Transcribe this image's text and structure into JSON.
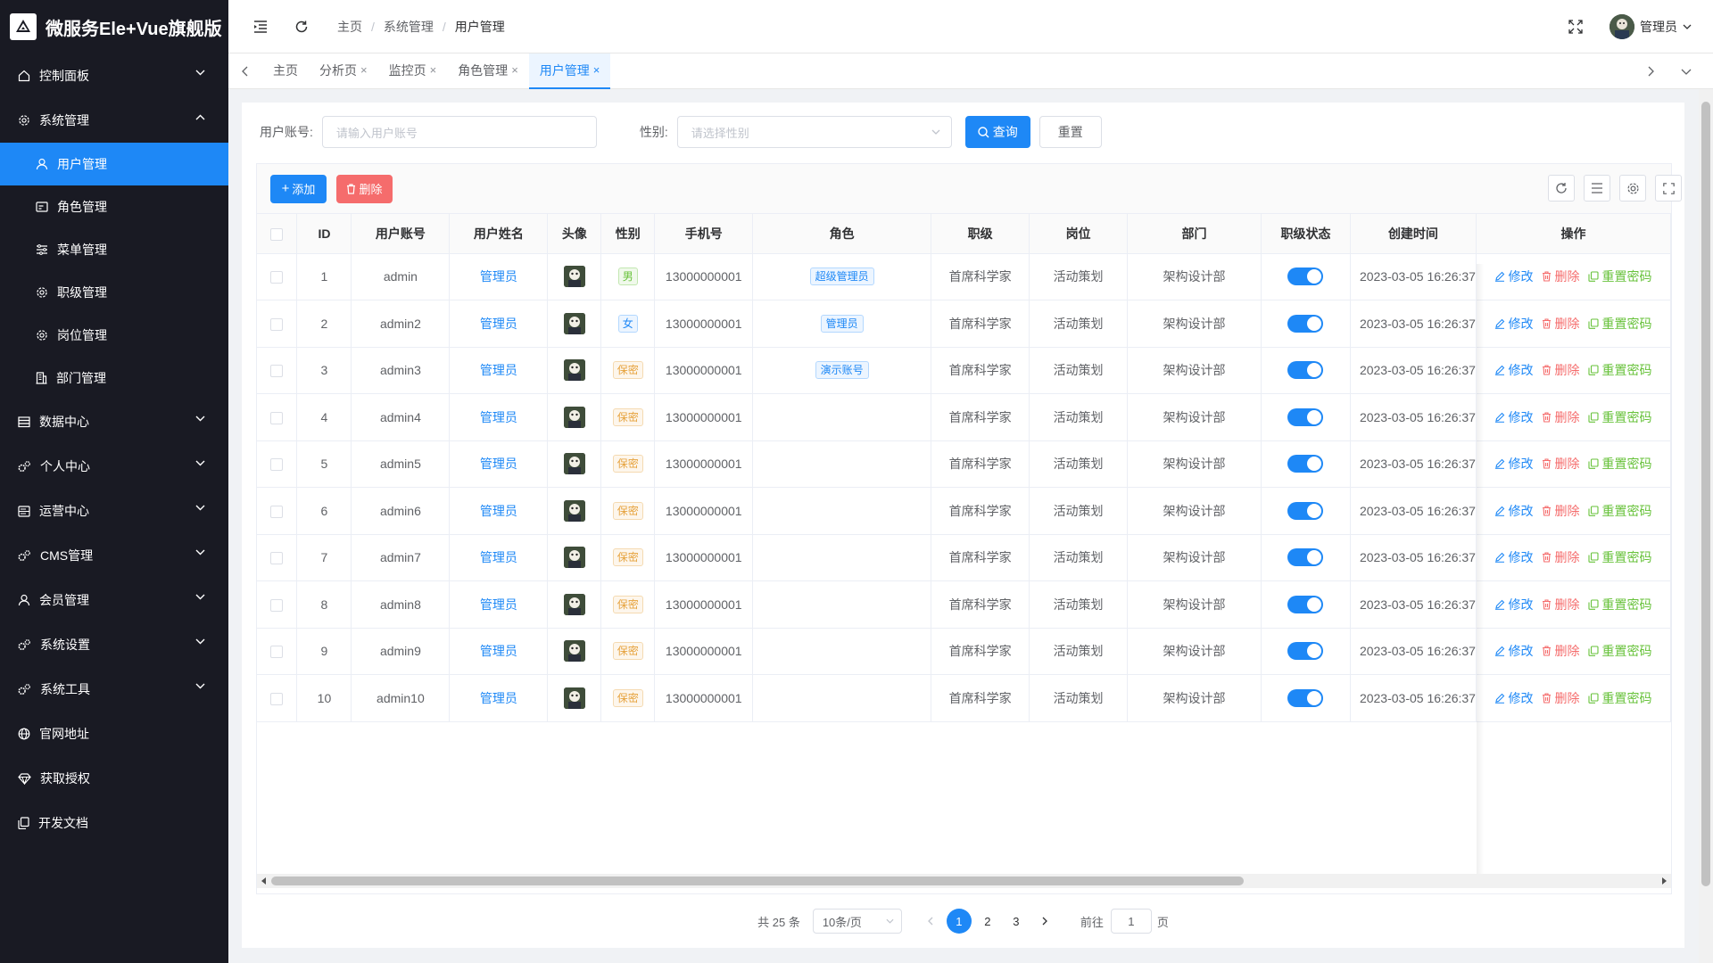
{
  "app": {
    "title": "微服务Ele+Vue旗舰版"
  },
  "sidebar": {
    "items": [
      {
        "label": "控制面板",
        "icon": "home-icon",
        "expanded": false
      },
      {
        "label": "系统管理",
        "icon": "gear-icon",
        "expanded": true,
        "children": [
          {
            "label": "用户管理",
            "icon": "user-icon",
            "active": true
          },
          {
            "label": "角色管理",
            "icon": "id-card-icon"
          },
          {
            "label": "菜单管理",
            "icon": "sliders-icon"
          },
          {
            "label": "职级管理",
            "icon": "gear-icon"
          },
          {
            "label": "岗位管理",
            "icon": "gear-icon"
          },
          {
            "label": "部门管理",
            "icon": "building-icon"
          }
        ]
      },
      {
        "label": "数据中心",
        "icon": "database-icon",
        "expanded": false
      },
      {
        "label": "个人中心",
        "icon": "gears-icon",
        "expanded": false
      },
      {
        "label": "运营中心",
        "icon": "server-icon",
        "expanded": false
      },
      {
        "label": "CMS管理",
        "icon": "gears-icon",
        "expanded": false
      },
      {
        "label": "会员管理",
        "icon": "user-icon",
        "expanded": false
      },
      {
        "label": "系统设置",
        "icon": "gears-icon",
        "expanded": false
      },
      {
        "label": "系统工具",
        "icon": "gears-icon",
        "expanded": false
      },
      {
        "label": "官网地址",
        "icon": "globe-icon"
      },
      {
        "label": "获取授权",
        "icon": "diamond-icon"
      },
      {
        "label": "开发文档",
        "icon": "copy-icon"
      }
    ]
  },
  "header": {
    "breadcrumb": [
      "主页",
      "系统管理",
      "用户管理"
    ],
    "user_name": "管理员"
  },
  "tabs": [
    {
      "label": "主页",
      "closable": false
    },
    {
      "label": "分析页",
      "closable": true
    },
    {
      "label": "监控页",
      "closable": true
    },
    {
      "label": "角色管理",
      "closable": true
    },
    {
      "label": "用户管理",
      "closable": true,
      "active": true
    }
  ],
  "search": {
    "account_label": "用户账号:",
    "account_placeholder": "请输入用户账号",
    "gender_label": "性别:",
    "gender_placeholder": "请选择性别",
    "query_label": "查询",
    "reset_label": "重置"
  },
  "toolbar": {
    "add_label": "添加",
    "delete_label": "删除"
  },
  "table": {
    "columns": [
      "",
      "ID",
      "用户账号",
      "用户姓名",
      "头像",
      "性别",
      "手机号",
      "角色",
      "职级",
      "岗位",
      "部门",
      "职级状态",
      "创建时间",
      "操作"
    ],
    "rows": [
      {
        "id": "1",
        "account": "admin",
        "name": "管理员",
        "gender": "男",
        "gender_type": "m",
        "phone": "13000000001",
        "role": "超级管理员",
        "rank": "首席科学家",
        "post": "活动策划",
        "dept": "架构设计部",
        "status": true,
        "created": "2023-03-05 16:26:37"
      },
      {
        "id": "2",
        "account": "admin2",
        "name": "管理员",
        "gender": "女",
        "gender_type": "f",
        "phone": "13000000001",
        "role": "管理员",
        "rank": "首席科学家",
        "post": "活动策划",
        "dept": "架构设计部",
        "status": true,
        "created": "2023-03-05 16:26:37"
      },
      {
        "id": "3",
        "account": "admin3",
        "name": "管理员",
        "gender": "保密",
        "gender_type": "s",
        "phone": "13000000001",
        "role": "演示账号",
        "rank": "首席科学家",
        "post": "活动策划",
        "dept": "架构设计部",
        "status": true,
        "created": "2023-03-05 16:26:37"
      },
      {
        "id": "4",
        "account": "admin4",
        "name": "管理员",
        "gender": "保密",
        "gender_type": "s",
        "phone": "13000000001",
        "role": "",
        "rank": "首席科学家",
        "post": "活动策划",
        "dept": "架构设计部",
        "status": true,
        "created": "2023-03-05 16:26:37"
      },
      {
        "id": "5",
        "account": "admin5",
        "name": "管理员",
        "gender": "保密",
        "gender_type": "s",
        "phone": "13000000001",
        "role": "",
        "rank": "首席科学家",
        "post": "活动策划",
        "dept": "架构设计部",
        "status": true,
        "created": "2023-03-05 16:26:37"
      },
      {
        "id": "6",
        "account": "admin6",
        "name": "管理员",
        "gender": "保密",
        "gender_type": "s",
        "phone": "13000000001",
        "role": "",
        "rank": "首席科学家",
        "post": "活动策划",
        "dept": "架构设计部",
        "status": true,
        "created": "2023-03-05 16:26:37"
      },
      {
        "id": "7",
        "account": "admin7",
        "name": "管理员",
        "gender": "保密",
        "gender_type": "s",
        "phone": "13000000001",
        "role": "",
        "rank": "首席科学家",
        "post": "活动策划",
        "dept": "架构设计部",
        "status": true,
        "created": "2023-03-05 16:26:37"
      },
      {
        "id": "8",
        "account": "admin8",
        "name": "管理员",
        "gender": "保密",
        "gender_type": "s",
        "phone": "13000000001",
        "role": "",
        "rank": "首席科学家",
        "post": "活动策划",
        "dept": "架构设计部",
        "status": true,
        "created": "2023-03-05 16:26:37"
      },
      {
        "id": "9",
        "account": "admin9",
        "name": "管理员",
        "gender": "保密",
        "gender_type": "s",
        "phone": "13000000001",
        "role": "",
        "rank": "首席科学家",
        "post": "活动策划",
        "dept": "架构设计部",
        "status": true,
        "created": "2023-03-05 16:26:37"
      },
      {
        "id": "10",
        "account": "admin10",
        "name": "管理员",
        "gender": "保密",
        "gender_type": "s",
        "phone": "13000000001",
        "role": "",
        "rank": "首席科学家",
        "post": "活动策划",
        "dept": "架构设计部",
        "status": true,
        "created": "2023-03-05 16:26:37"
      }
    ],
    "actions": {
      "edit": "修改",
      "delete": "删除",
      "reset": "重置密码"
    }
  },
  "pagination": {
    "total_text": "共 25 条",
    "page_size": "10条/页",
    "pages": [
      "1",
      "2",
      "3"
    ],
    "current": "1",
    "goto_label": "前往",
    "goto_value": "1",
    "page_unit": "页"
  },
  "colors": {
    "primary": "#1e88f6",
    "danger": "#f56c6c",
    "success": "#67c23a",
    "warning": "#e6a23c",
    "sidebar_bg": "#191a23"
  }
}
